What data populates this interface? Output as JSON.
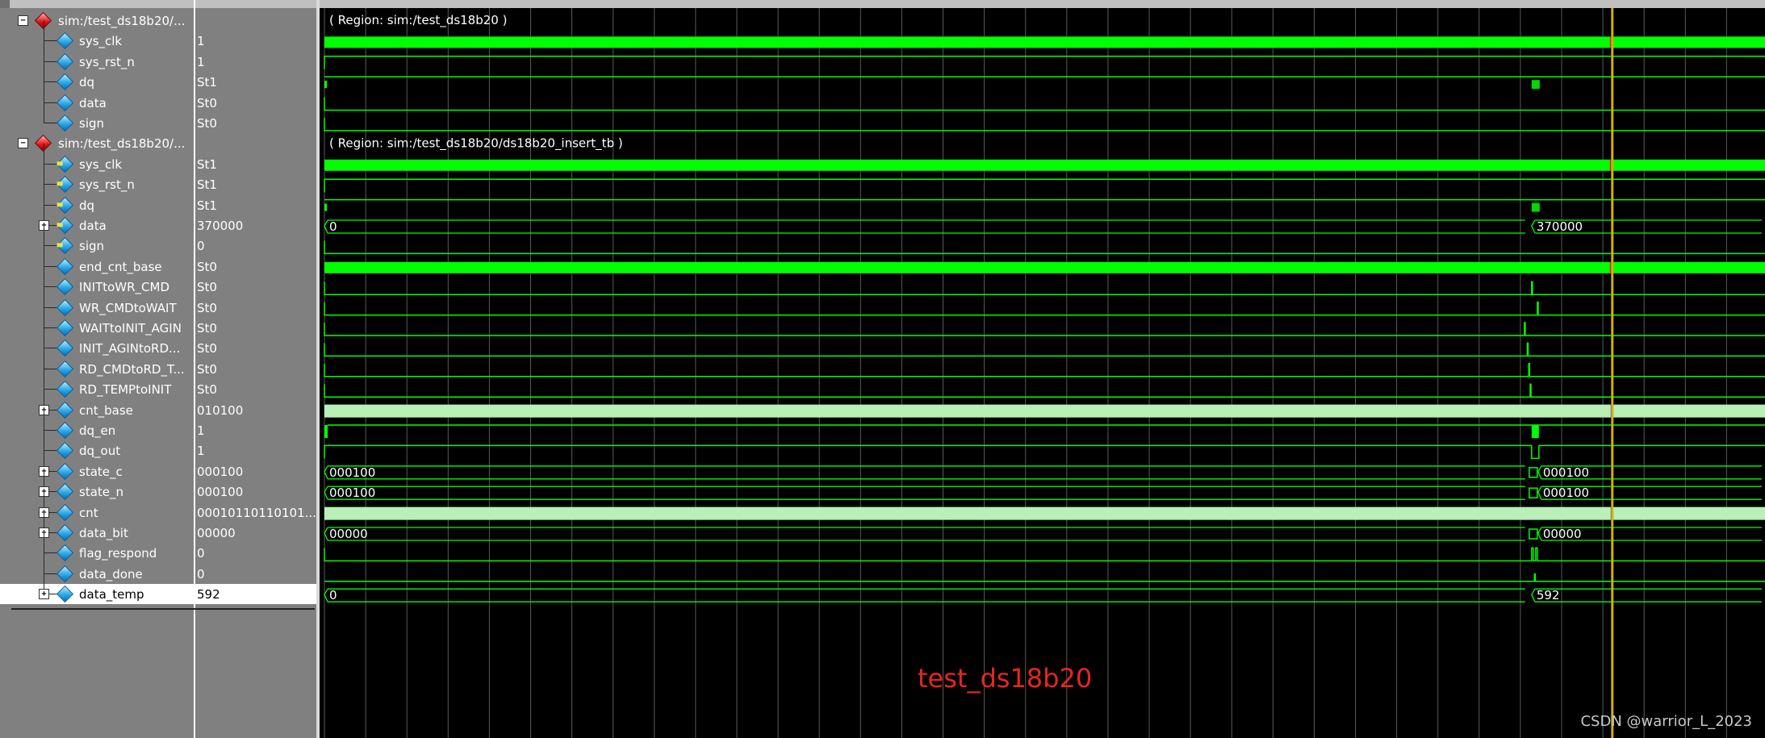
{
  "colors": {
    "waveform": "#00ff00",
    "bus_fill": "#b8f0b8",
    "background": "#000000",
    "grid": "#5a5a5a",
    "cursor": "#d4b000",
    "region_text": "#ffffff",
    "caption": "#e8251e",
    "selected_row": "#ffffff"
  },
  "signals": [
    {
      "name": "sim:/test_ds18b20/...",
      "value": "",
      "kind": "region",
      "icon": "region-diamond-icon",
      "expand": "-"
    },
    {
      "name": "sys_clk",
      "value": "1",
      "kind": "signal",
      "icon": "signal-diamond-icon"
    },
    {
      "name": "sys_rst_n",
      "value": "1",
      "kind": "signal",
      "icon": "signal-diamond-icon"
    },
    {
      "name": "dq",
      "value": "St1",
      "kind": "signal",
      "icon": "signal-diamond-icon"
    },
    {
      "name": "data",
      "value": "St0",
      "kind": "signal",
      "icon": "signal-diamond-icon"
    },
    {
      "name": "sign",
      "value": "St0",
      "kind": "signal",
      "icon": "signal-diamond-icon"
    },
    {
      "name": "sim:/test_ds18b20/...",
      "value": "",
      "kind": "region",
      "icon": "region-diamond-icon",
      "expand": "-"
    },
    {
      "name": "sys_clk",
      "value": "St1",
      "kind": "signal",
      "icon": "input-port-icon",
      "port": true
    },
    {
      "name": "sys_rst_n",
      "value": "St1",
      "kind": "signal",
      "icon": "input-port-icon",
      "port": true
    },
    {
      "name": "dq",
      "value": "St1",
      "kind": "signal",
      "icon": "inout-port-icon",
      "port": true
    },
    {
      "name": "data",
      "value": "370000",
      "kind": "signal",
      "icon": "output-port-icon",
      "port": true,
      "expand": "+"
    },
    {
      "name": "sign",
      "value": "0",
      "kind": "signal",
      "icon": "output-port-icon",
      "port": true
    },
    {
      "name": "end_cnt_base",
      "value": "St0",
      "kind": "signal",
      "icon": "signal-diamond-icon"
    },
    {
      "name": "INITtoWR_CMD",
      "value": "St0",
      "kind": "signal",
      "icon": "signal-diamond-icon"
    },
    {
      "name": "WR_CMDtoWAIT",
      "value": "St0",
      "kind": "signal",
      "icon": "signal-diamond-icon"
    },
    {
      "name": "WAITtoINIT_AGIN",
      "value": "St0",
      "kind": "signal",
      "icon": "signal-diamond-icon"
    },
    {
      "name": "INIT_AGINtoRD...",
      "value": "St0",
      "kind": "signal",
      "icon": "signal-diamond-icon"
    },
    {
      "name": "RD_CMDtoRD_T...",
      "value": "St0",
      "kind": "signal",
      "icon": "signal-diamond-icon"
    },
    {
      "name": "RD_TEMPtoINIT",
      "value": "St0",
      "kind": "signal",
      "icon": "signal-diamond-icon"
    },
    {
      "name": "cnt_base",
      "value": "010100",
      "kind": "signal",
      "icon": "signal-diamond-icon",
      "expand": "+"
    },
    {
      "name": "dq_en",
      "value": "1",
      "kind": "signal",
      "icon": "signal-diamond-icon"
    },
    {
      "name": "dq_out",
      "value": "1",
      "kind": "signal",
      "icon": "signal-diamond-icon"
    },
    {
      "name": "state_c",
      "value": "000100",
      "kind": "signal",
      "icon": "signal-diamond-icon",
      "expand": "+"
    },
    {
      "name": "state_n",
      "value": "000100",
      "kind": "signal",
      "icon": "signal-diamond-icon",
      "expand": "+"
    },
    {
      "name": "cnt",
      "value": "00010110110101...",
      "kind": "signal",
      "icon": "signal-diamond-icon",
      "expand": "+"
    },
    {
      "name": "data_bit",
      "value": "00000",
      "kind": "signal",
      "icon": "signal-diamond-icon",
      "expand": "+"
    },
    {
      "name": "flag_respond",
      "value": "0",
      "kind": "signal",
      "icon": "signal-diamond-icon"
    },
    {
      "name": "data_done",
      "value": "0",
      "kind": "signal",
      "icon": "signal-diamond-icon"
    },
    {
      "name": "data_temp",
      "value": "592",
      "kind": "signal",
      "icon": "signal-diamond-icon",
      "expand": "+",
      "selected": true
    }
  ],
  "waves": [
    {
      "type": "region",
      "label": "( Region: sim:/test_ds18b20 )"
    },
    {
      "type": "clock"
    },
    {
      "type": "high"
    },
    {
      "type": "dq"
    },
    {
      "type": "low"
    },
    {
      "type": "low"
    },
    {
      "type": "region",
      "label": "( Region: sim:/test_ds18b20/ds18b20_insert_tb )"
    },
    {
      "type": "clock"
    },
    {
      "type": "high"
    },
    {
      "type": "dq"
    },
    {
      "type": "bus",
      "labels": [
        "0",
        "370000"
      ]
    },
    {
      "type": "low"
    },
    {
      "type": "clock"
    },
    {
      "type": "pulse",
      "at": 0.838
    },
    {
      "type": "pulse",
      "at": 0.842
    },
    {
      "type": "pulse",
      "at": 0.833
    },
    {
      "type": "pulse",
      "at": 0.835
    },
    {
      "type": "pulse",
      "at": 0.836
    },
    {
      "type": "pulse",
      "at": 0.837
    },
    {
      "type": "fill"
    },
    {
      "type": "dq_en"
    },
    {
      "type": "dq_out"
    },
    {
      "type": "bus",
      "labels": [
        "000100",
        "000100"
      ],
      "glitch": true
    },
    {
      "type": "bus",
      "labels": [
        "000100",
        "000100"
      ],
      "glitch": true
    },
    {
      "type": "fill"
    },
    {
      "type": "bus",
      "labels": [
        "00000",
        "00000"
      ],
      "glitch": true
    },
    {
      "type": "flag"
    },
    {
      "type": "low_pulse",
      "at": 0.84
    },
    {
      "type": "bus",
      "labels": [
        "0",
        "592"
      ]
    }
  ],
  "caption": "test_ds18b20",
  "watermark": "CSDN @warrior_L_2023"
}
